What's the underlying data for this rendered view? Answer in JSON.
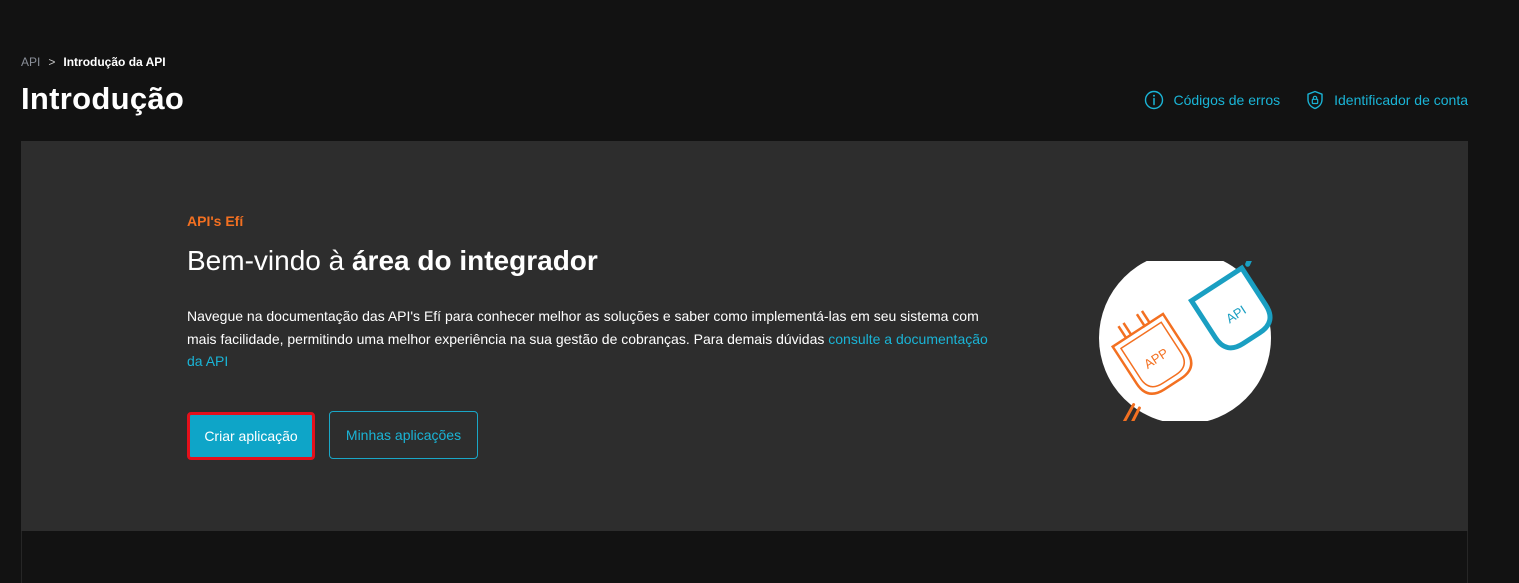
{
  "breadcrumb": {
    "root": "API",
    "separator": ">",
    "current": "Introdução da API"
  },
  "page_title": "Introdução",
  "top_links": {
    "error_codes": {
      "label": "Códigos de erros",
      "icon": "info-circle-icon"
    },
    "account_id": {
      "label": "Identificador de conta",
      "icon": "shield-lock-icon"
    }
  },
  "hero": {
    "eyebrow": "API's Efí",
    "title_regular": "Bem-vindo à ",
    "title_bold": "área do integrador",
    "description": "Navegue na documentação das API's Efí para conhecer melhor as soluções e saber como implementá-las em seu sistema com mais facilidade, permitindo uma melhor experiência na sua gestão de cobranças. Para demais dúvidas ",
    "description_link": "consulte a documentação da API",
    "primary_button": "Criar aplicação",
    "secondary_button": "Minhas aplicações",
    "illustration": {
      "app_label": "APP",
      "api_label": "API"
    }
  },
  "colors": {
    "background": "#121212",
    "panel": "#2d2d2d",
    "accent": "#1ab4d6",
    "orange": "#f37021",
    "primary_button": "#0ea5c8",
    "highlight_border": "#e3101b"
  }
}
